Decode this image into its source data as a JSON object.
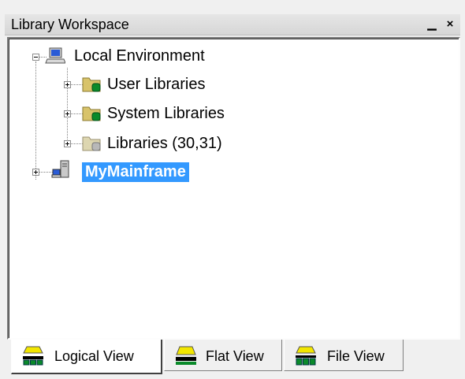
{
  "window": {
    "title": "Library Workspace",
    "buttons": {
      "restore": "▁",
      "close": "×"
    }
  },
  "tree": {
    "root": {
      "label": "Local Environment",
      "icon": "computer-icon",
      "expanded": true,
      "children": [
        {
          "label": "User Libraries",
          "icon": "folder-green-db-icon"
        },
        {
          "label": "System Libraries",
          "icon": "folder-green-db-icon"
        },
        {
          "label": "Libraries (30,31)",
          "icon": "folder-gray-db-icon"
        }
      ]
    },
    "server": {
      "label": "MyMainframe",
      "icon": "mainframe-server-icon",
      "selected": true
    }
  },
  "tabs": [
    {
      "label": "Logical View",
      "icon": "logical-view-icon",
      "active": true
    },
    {
      "label": "Flat View",
      "icon": "flat-view-icon",
      "active": false
    },
    {
      "label": "File View",
      "icon": "file-view-icon",
      "active": false
    }
  ],
  "colors": {
    "selection": "#3399ff",
    "folder": "#d8c36a",
    "db_green": "#0a8a2a",
    "tab_icon_yellow": "#f2e600"
  }
}
